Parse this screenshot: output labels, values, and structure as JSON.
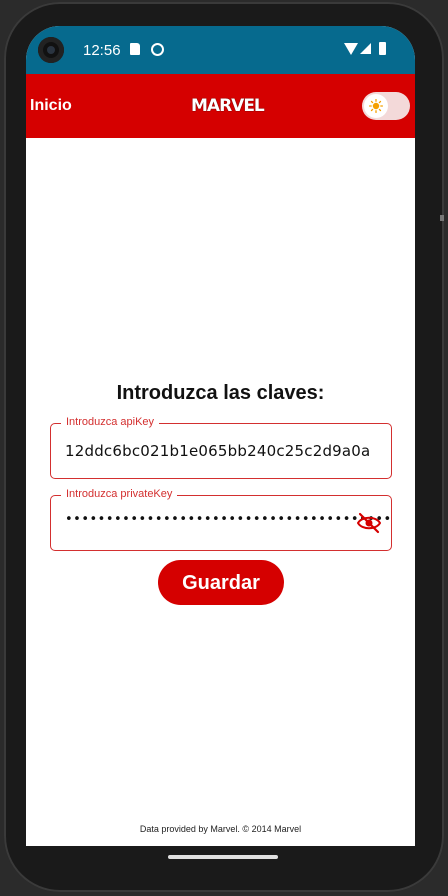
{
  "status": {
    "time": "12:56",
    "icons": [
      "sd-card-icon",
      "sync-icon",
      "wifi-icon",
      "signal-icon",
      "battery-icon"
    ]
  },
  "appbar": {
    "title": "Inicio",
    "logo_text": "MARVEL",
    "theme_toggle_icon": "sun-icon"
  },
  "form": {
    "heading": "Introduzca las claves:",
    "api_label": "Introduzca apiKey",
    "api_value": "12ddc6bc021b1e065bb240c25c2d9a0a",
    "private_label": "Introduzca privateKey",
    "private_value_masked": "••••••••••••••••••••••••••••••••••••••••",
    "visibility_icon": "eye-off-icon",
    "save_label": "Guardar"
  },
  "footer": {
    "credit": "Data provided by Marvel. © 2014 Marvel"
  },
  "colors": {
    "status_bar": "#066a8e",
    "app_bar": "#d50000",
    "field_border": "#d32f2f",
    "button": "#d50000"
  }
}
